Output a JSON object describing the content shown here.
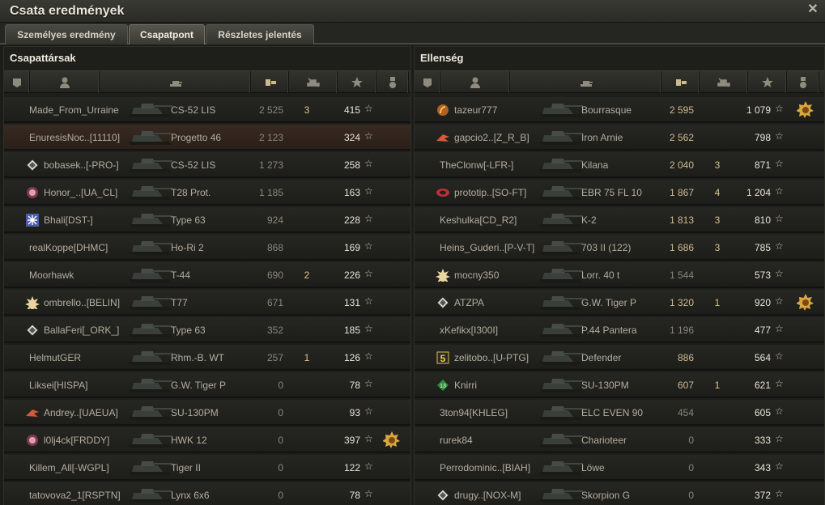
{
  "window": {
    "title": "Csata eredmények"
  },
  "tabs": [
    {
      "label": "Személyes eredmény"
    },
    {
      "label": "Csapatpont"
    },
    {
      "label": "Részletes jelentés"
    }
  ],
  "colors": {
    "accent": "#cdbb8c",
    "highlight_row": "#382a22",
    "medal": "#d9a741"
  },
  "allies": {
    "title": "Csapattársak",
    "columns": [
      "platoon-icon",
      "player-icon",
      "tank-icon",
      "damage-icon",
      "kills-icon",
      "experience-icon",
      "medal-icon"
    ],
    "rows": [
      {
        "clan_icon": "",
        "player": "Made_From_Urraine",
        "tank": "CS-52 LIS",
        "damage": "2 525",
        "kills": "3",
        "xp": "415",
        "medal": false,
        "highlight": false
      },
      {
        "clan_icon": "",
        "player": "EnuresisNoc..[11110]",
        "tank": "Progetto 46",
        "damage": "2 123",
        "kills": "",
        "xp": "324",
        "medal": false,
        "highlight": true
      },
      {
        "clan_icon": "diamond-clan-icon",
        "player": "bobasek..[-PRO-]",
        "tank": "CS-52 LIS",
        "damage": "1 273",
        "kills": "",
        "xp": "258",
        "medal": false,
        "highlight": false
      },
      {
        "clan_icon": "emblem-clan-icon",
        "player": "Honor_..[UA_CL]",
        "tank": "T28 Prot.",
        "damage": "1 185",
        "kills": "",
        "xp": "163",
        "medal": false,
        "highlight": false
      },
      {
        "clan_icon": "snowflake-clan-icon",
        "player": "Bhali[DST-]",
        "tank": "Type 63",
        "damage": "924",
        "kills": "",
        "xp": "228",
        "medal": false,
        "highlight": false
      },
      {
        "clan_icon": "",
        "player": "realKoppe[DHMC]",
        "tank": "Ho-Ri 2",
        "damage": "868",
        "kills": "",
        "xp": "169",
        "medal": false,
        "highlight": false
      },
      {
        "clan_icon": "",
        "player": "Moorhawk",
        "tank": "T-44",
        "damage": "690",
        "kills": "2",
        "xp": "226",
        "medal": false,
        "highlight": false
      },
      {
        "clan_icon": "sun-clan-icon",
        "player": "ombrello..[BELIN]",
        "tank": "T77",
        "damage": "671",
        "kills": "",
        "xp": "131",
        "medal": false,
        "highlight": false
      },
      {
        "clan_icon": "diamond-clan-icon",
        "player": "BallaFeri[_ORK_]",
        "tank": "Type 63",
        "damage": "352",
        "kills": "",
        "xp": "185",
        "medal": false,
        "highlight": false
      },
      {
        "clan_icon": "",
        "player": "HelmutGER",
        "tank": "Rhm.-B. WT",
        "damage": "257",
        "kills": "1",
        "xp": "126",
        "medal": false,
        "highlight": false
      },
      {
        "clan_icon": "",
        "player": "Liksei[HISPA]",
        "tank": "G.W. Tiger P",
        "damage": "0",
        "kills": "",
        "xp": "78",
        "medal": false,
        "highlight": false
      },
      {
        "clan_icon": "wings-clan-icon",
        "player": "Andrey..[UAEUA]",
        "tank": "SU-130PM",
        "damage": "0",
        "kills": "",
        "xp": "93",
        "medal": false,
        "highlight": false
      },
      {
        "clan_icon": "emblem-clan-icon",
        "player": "l0lj4ck[FRDDY]",
        "tank": "HWK 12",
        "damage": "0",
        "kills": "",
        "xp": "397",
        "medal": true,
        "highlight": false
      },
      {
        "clan_icon": "",
        "player": "Killem_All[-WGPL]",
        "tank": "Tiger II",
        "damage": "0",
        "kills": "",
        "xp": "122",
        "medal": false,
        "highlight": false
      },
      {
        "clan_icon": "",
        "player": "tatovova2_1[RSPTN]",
        "tank": "Lynx 6x6",
        "damage": "0",
        "kills": "",
        "xp": "78",
        "medal": false,
        "highlight": false
      }
    ]
  },
  "enemies": {
    "title": "Ellenség",
    "columns": [
      "platoon-icon",
      "player-icon",
      "tank-icon",
      "damage-icon",
      "kills-icon",
      "experience-icon",
      "medal-icon"
    ],
    "rows": [
      {
        "clan_icon": "crest-clan-icon",
        "player": "tazeur777",
        "tank": "Bourrasque",
        "damage": "2 595",
        "kills": "",
        "xp": "1 079",
        "medal": true
      },
      {
        "clan_icon": "wings-clan-icon",
        "player": "gapcio2..[Z_R_B]",
        "tank": "Iron Arnie",
        "damage": "2 562",
        "kills": "",
        "xp": "798",
        "medal": false
      },
      {
        "clan_icon": "",
        "player": "TheClonw[-LFR-]",
        "tank": "Kilana",
        "damage": "2 040",
        "kills": "3",
        "xp": "871",
        "medal": false
      },
      {
        "clan_icon": "eye-clan-icon",
        "player": "prototip..[SO-FT]",
        "tank": "EBR 75 FL 10",
        "damage": "1 867",
        "kills": "4",
        "xp": "1 204",
        "medal": false
      },
      {
        "clan_icon": "",
        "player": "Keshulka[CD_R2]",
        "tank": "K-2",
        "damage": "1 813",
        "kills": "3",
        "xp": "810",
        "medal": false
      },
      {
        "clan_icon": "",
        "player": "Heins_Guderi..[P-V-T]",
        "tank": "703 II (122)",
        "damage": "1 686",
        "kills": "3",
        "xp": "785",
        "medal": false
      },
      {
        "clan_icon": "sun-clan-icon",
        "player": "mocny350",
        "tank": "Lorr. 40 t",
        "damage": "1 544",
        "kills": "",
        "xp": "573",
        "medal": false
      },
      {
        "clan_icon": "diamond-clan-icon",
        "player": "ATZPA",
        "tank": "G.W. Tiger P",
        "damage": "1 320",
        "kills": "1",
        "xp": "920",
        "medal": true
      },
      {
        "clan_icon": "",
        "player": "xKefikx[I300I]",
        "tank": "P.44 Pantera",
        "damage": "1 196",
        "kills": "",
        "xp": "477",
        "medal": false
      },
      {
        "clan_icon": "five-clan-icon",
        "player": "zelitobo..[U-PTG]",
        "tank": "Defender",
        "damage": "886",
        "kills": "",
        "xp": "564",
        "medal": false
      },
      {
        "clan_icon": "thirteen-clan-icon",
        "player": "Knirri",
        "tank": "SU-130PM",
        "damage": "607",
        "kills": "1",
        "xp": "621",
        "medal": false
      },
      {
        "clan_icon": "",
        "player": "3ton94[KHLEG]",
        "tank": "ELC EVEN 90",
        "damage": "454",
        "kills": "",
        "xp": "605",
        "medal": false
      },
      {
        "clan_icon": "",
        "player": "rurek84",
        "tank": "Charioteer",
        "damage": "0",
        "kills": "",
        "xp": "333",
        "medal": false
      },
      {
        "clan_icon": "",
        "player": "Perrodominic..[BIAH]",
        "tank": "Löwe",
        "damage": "0",
        "kills": "",
        "xp": "343",
        "medal": false
      },
      {
        "clan_icon": "diamond-clan-icon",
        "player": "drugy..[NOX-M]",
        "tank": "Skorpion G",
        "damage": "0",
        "kills": "",
        "xp": "372",
        "medal": false
      }
    ]
  }
}
